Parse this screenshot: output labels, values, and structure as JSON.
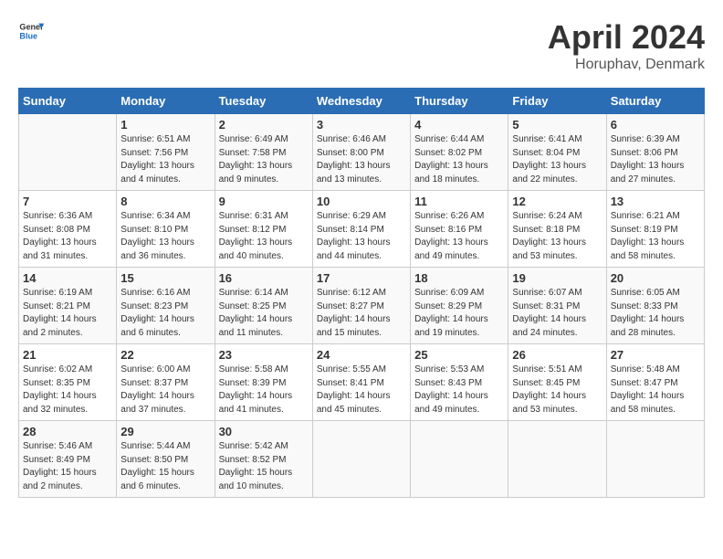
{
  "header": {
    "logo_general": "General",
    "logo_blue": "Blue",
    "month": "April 2024",
    "location": "Horuphav, Denmark"
  },
  "days_of_week": [
    "Sunday",
    "Monday",
    "Tuesday",
    "Wednesday",
    "Thursday",
    "Friday",
    "Saturday"
  ],
  "weeks": [
    [
      {
        "day": "",
        "info": ""
      },
      {
        "day": "1",
        "info": "Sunrise: 6:51 AM\nSunset: 7:56 PM\nDaylight: 13 hours\nand 4 minutes."
      },
      {
        "day": "2",
        "info": "Sunrise: 6:49 AM\nSunset: 7:58 PM\nDaylight: 13 hours\nand 9 minutes."
      },
      {
        "day": "3",
        "info": "Sunrise: 6:46 AM\nSunset: 8:00 PM\nDaylight: 13 hours\nand 13 minutes."
      },
      {
        "day": "4",
        "info": "Sunrise: 6:44 AM\nSunset: 8:02 PM\nDaylight: 13 hours\nand 18 minutes."
      },
      {
        "day": "5",
        "info": "Sunrise: 6:41 AM\nSunset: 8:04 PM\nDaylight: 13 hours\nand 22 minutes."
      },
      {
        "day": "6",
        "info": "Sunrise: 6:39 AM\nSunset: 8:06 PM\nDaylight: 13 hours\nand 27 minutes."
      }
    ],
    [
      {
        "day": "7",
        "info": "Sunrise: 6:36 AM\nSunset: 8:08 PM\nDaylight: 13 hours\nand 31 minutes."
      },
      {
        "day": "8",
        "info": "Sunrise: 6:34 AM\nSunset: 8:10 PM\nDaylight: 13 hours\nand 36 minutes."
      },
      {
        "day": "9",
        "info": "Sunrise: 6:31 AM\nSunset: 8:12 PM\nDaylight: 13 hours\nand 40 minutes."
      },
      {
        "day": "10",
        "info": "Sunrise: 6:29 AM\nSunset: 8:14 PM\nDaylight: 13 hours\nand 44 minutes."
      },
      {
        "day": "11",
        "info": "Sunrise: 6:26 AM\nSunset: 8:16 PM\nDaylight: 13 hours\nand 49 minutes."
      },
      {
        "day": "12",
        "info": "Sunrise: 6:24 AM\nSunset: 8:18 PM\nDaylight: 13 hours\nand 53 minutes."
      },
      {
        "day": "13",
        "info": "Sunrise: 6:21 AM\nSunset: 8:19 PM\nDaylight: 13 hours\nand 58 minutes."
      }
    ],
    [
      {
        "day": "14",
        "info": "Sunrise: 6:19 AM\nSunset: 8:21 PM\nDaylight: 14 hours\nand 2 minutes."
      },
      {
        "day": "15",
        "info": "Sunrise: 6:16 AM\nSunset: 8:23 PM\nDaylight: 14 hours\nand 6 minutes."
      },
      {
        "day": "16",
        "info": "Sunrise: 6:14 AM\nSunset: 8:25 PM\nDaylight: 14 hours\nand 11 minutes."
      },
      {
        "day": "17",
        "info": "Sunrise: 6:12 AM\nSunset: 8:27 PM\nDaylight: 14 hours\nand 15 minutes."
      },
      {
        "day": "18",
        "info": "Sunrise: 6:09 AM\nSunset: 8:29 PM\nDaylight: 14 hours\nand 19 minutes."
      },
      {
        "day": "19",
        "info": "Sunrise: 6:07 AM\nSunset: 8:31 PM\nDaylight: 14 hours\nand 24 minutes."
      },
      {
        "day": "20",
        "info": "Sunrise: 6:05 AM\nSunset: 8:33 PM\nDaylight: 14 hours\nand 28 minutes."
      }
    ],
    [
      {
        "day": "21",
        "info": "Sunrise: 6:02 AM\nSunset: 8:35 PM\nDaylight: 14 hours\nand 32 minutes."
      },
      {
        "day": "22",
        "info": "Sunrise: 6:00 AM\nSunset: 8:37 PM\nDaylight: 14 hours\nand 37 minutes."
      },
      {
        "day": "23",
        "info": "Sunrise: 5:58 AM\nSunset: 8:39 PM\nDaylight: 14 hours\nand 41 minutes."
      },
      {
        "day": "24",
        "info": "Sunrise: 5:55 AM\nSunset: 8:41 PM\nDaylight: 14 hours\nand 45 minutes."
      },
      {
        "day": "25",
        "info": "Sunrise: 5:53 AM\nSunset: 8:43 PM\nDaylight: 14 hours\nand 49 minutes."
      },
      {
        "day": "26",
        "info": "Sunrise: 5:51 AM\nSunset: 8:45 PM\nDaylight: 14 hours\nand 53 minutes."
      },
      {
        "day": "27",
        "info": "Sunrise: 5:48 AM\nSunset: 8:47 PM\nDaylight: 14 hours\nand 58 minutes."
      }
    ],
    [
      {
        "day": "28",
        "info": "Sunrise: 5:46 AM\nSunset: 8:49 PM\nDaylight: 15 hours\nand 2 minutes."
      },
      {
        "day": "29",
        "info": "Sunrise: 5:44 AM\nSunset: 8:50 PM\nDaylight: 15 hours\nand 6 minutes."
      },
      {
        "day": "30",
        "info": "Sunrise: 5:42 AM\nSunset: 8:52 PM\nDaylight: 15 hours\nand 10 minutes."
      },
      {
        "day": "",
        "info": ""
      },
      {
        "day": "",
        "info": ""
      },
      {
        "day": "",
        "info": ""
      },
      {
        "day": "",
        "info": ""
      }
    ]
  ]
}
